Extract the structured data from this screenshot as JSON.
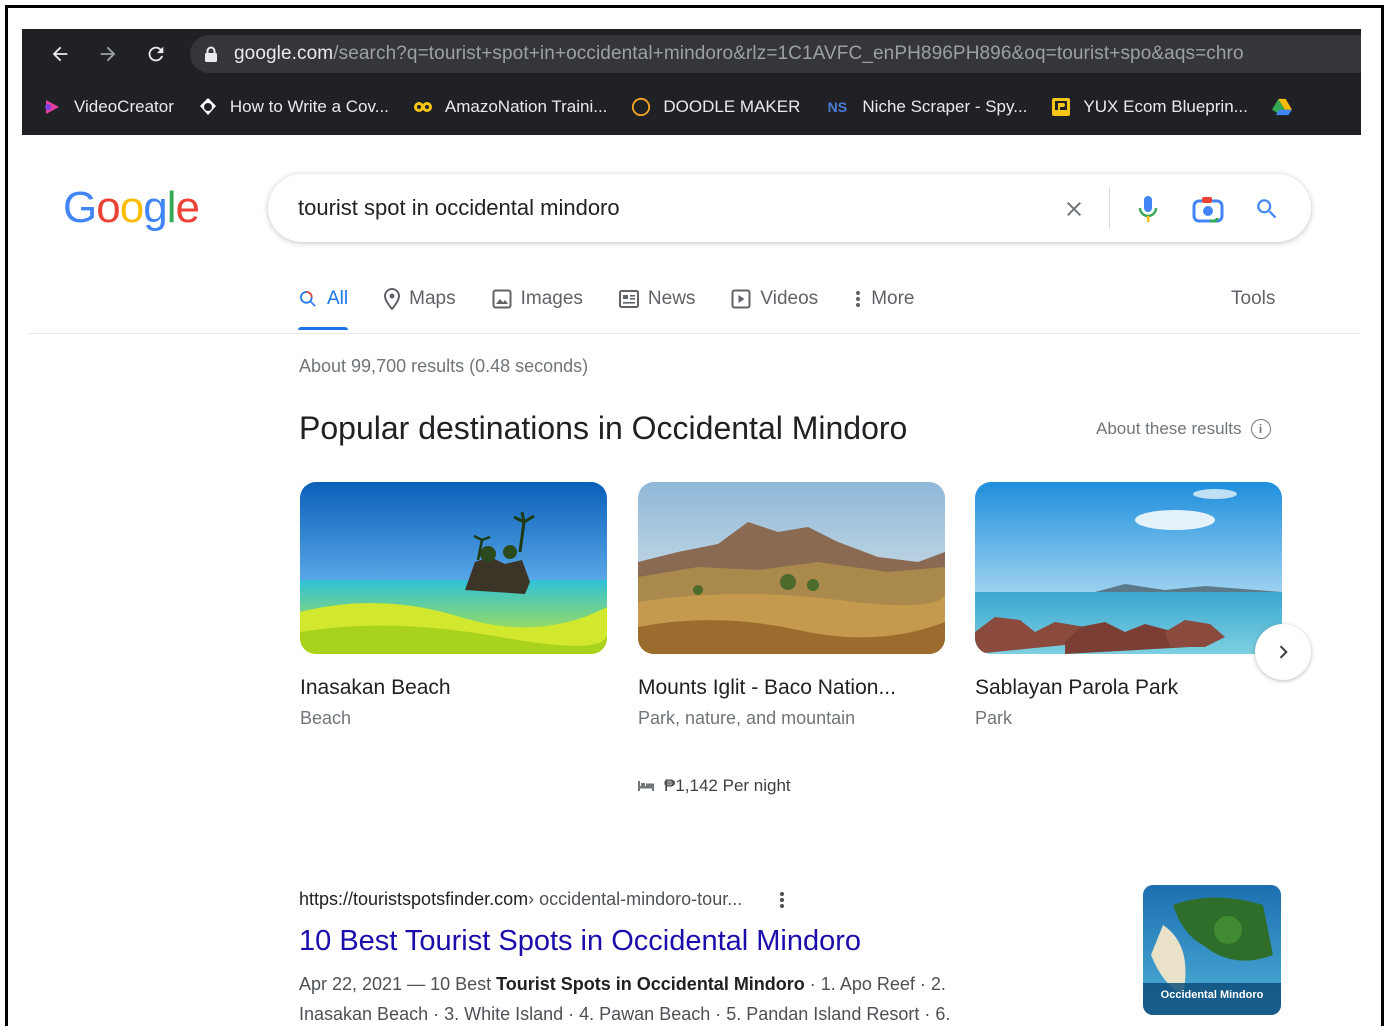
{
  "browser": {
    "url_host": "google.com",
    "url_rest": "/search?q=tourist+spot+in+occidental+mindoro&rlz=1C1AVFC_enPH896PH896&oq=tourist+spo&aqs=chro",
    "bookmarks": [
      {
        "label": "VideoCreator",
        "icon": "videocreator-icon",
        "color": "#e040a0"
      },
      {
        "label": "How to Write a Cov...",
        "icon": "globe-icon",
        "color": "#ffffff"
      },
      {
        "label": "AmazoNation Traini...",
        "icon": "owl-icon",
        "color": "#f5c518"
      },
      {
        "label": "DOODLE MAKER",
        "icon": "circle-icon",
        "color": "#f5a623"
      },
      {
        "label": "Niche Scraper - Spy...",
        "icon": "ns-icon",
        "color": "#4a7bd8"
      },
      {
        "label": "YUX Ecom Blueprin...",
        "icon": "yux-icon",
        "color": "#f5c518"
      },
      {
        "label": "",
        "icon": "google-drive-icon",
        "color": "#34a853"
      }
    ]
  },
  "search": {
    "query": "tourist spot in occidental mindoro"
  },
  "tabs": [
    {
      "label": "All",
      "icon": "search-icon",
      "active": true
    },
    {
      "label": "Maps",
      "icon": "map-pin-icon",
      "active": false
    },
    {
      "label": "Images",
      "icon": "image-icon",
      "active": false
    },
    {
      "label": "News",
      "icon": "news-icon",
      "active": false
    },
    {
      "label": "Videos",
      "icon": "video-icon",
      "active": false
    },
    {
      "label": "More",
      "icon": "more-vert-icon",
      "active": false
    }
  ],
  "tools_label": "Tools",
  "stats": "About 99,700 results (0.48 seconds)",
  "destinations": {
    "title": "Popular destinations in Occidental Mindoro",
    "about_label": "About these results",
    "cards": [
      {
        "name": "Inasakan Beach",
        "type": "Beach"
      },
      {
        "name": "Mounts Iglit - Baco Nation...",
        "type": "Park, nature, and mountain"
      },
      {
        "name": "Sablayan Parola Park",
        "type": "Park"
      }
    ],
    "price": "₱1,142 Per night"
  },
  "result": {
    "cite_host": "https://touristspotsfinder.com",
    "cite_path": " › occidental-mindoro-tour...",
    "title": "10 Best Tourist Spots in Occidental Mindoro",
    "snippet_date": "Apr 22, 2021 — 10 Best ",
    "snippet_bold": "Tourist Spots in Occidental Mindoro",
    "snippet_rest": " · 1. Apo Reef · 2.",
    "snippet_line2": "Inasakan Beach · 3. White Island · 4. Pawan Beach · 5. Pandan Island Resort · 6.",
    "thumb_caption": "Occidental Mindoro"
  },
  "colors": {
    "link": "#1a0dab",
    "accent": "#1a73e8",
    "chrome_bg": "#202124"
  }
}
